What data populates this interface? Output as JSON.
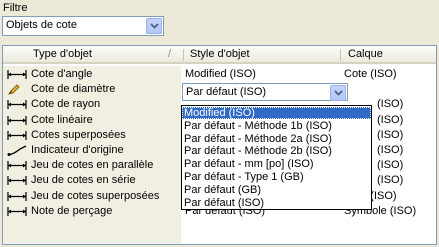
{
  "filter": {
    "label": "Filtre",
    "selected": "Objets de cote"
  },
  "table": {
    "columns": [
      "Type d'objet",
      "Style d'objet",
      "Calque"
    ],
    "rows": [
      {
        "icon": "linear-dimension-icon",
        "type": "Cote d'angle",
        "style": "Modified (ISO)",
        "layer": "Cote (ISO)"
      },
      {
        "icon": "pencil-icon",
        "type": "Cote de diamètre",
        "style": "Par défaut (ISO)",
        "layer": ""
      },
      {
        "icon": "linear-dimension-icon",
        "type": "Cote de rayon",
        "style": "",
        "layer": "(ISO)"
      },
      {
        "icon": "linear-dimension-icon",
        "type": "Cote linéaire",
        "style": "",
        "layer": "(ISO)"
      },
      {
        "icon": "linear-dimension-icon",
        "type": "Cotes superposées",
        "style": "",
        "layer": "(ISO)"
      },
      {
        "icon": "origin-indicator-icon",
        "type": "Indicateur d'origine",
        "style": "",
        "layer": "(ISO)"
      },
      {
        "icon": "linear-dimension-icon",
        "type": "Jeu de cotes en parallèle",
        "style": "",
        "layer": "(ISO)"
      },
      {
        "icon": "linear-dimension-icon",
        "type": "Jeu de cotes en série",
        "style": "",
        "layer": "(ISO)"
      },
      {
        "icon": "linear-dimension-icon",
        "type": "Jeu de cotes superposées",
        "style": "",
        "layer": "Cote (ISO)"
      },
      {
        "icon": "linear-dimension-icon",
        "type": "Note de perçage",
        "style": "Par défaut (ISO)",
        "layer": "Symbole (ISO)"
      }
    ]
  },
  "dropdown": {
    "current": "Par défaut (ISO)",
    "options": [
      "Modified (ISO)",
      "Par défaut - Méthode 1b (ISO)",
      "Par défaut - Méthode 2a (ISO)",
      "Par défaut - Méthode 2b (ISO)",
      "Par défaut - mm [po] (ISO)",
      "Par défaut - Type 1 (GB)",
      "Par défaut (GB)",
      "Par défaut (ISO)"
    ],
    "highlighted_index": 0
  },
  "colors": {
    "selection": "#316ac5",
    "type_column_bg": "#f0efe2",
    "border": "#7f9db9"
  }
}
